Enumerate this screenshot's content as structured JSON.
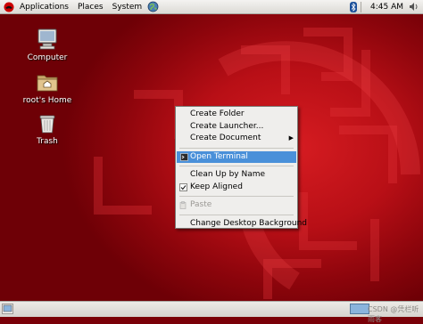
{
  "top_panel": {
    "menus": [
      "Applications",
      "Places",
      "System"
    ],
    "clock": "4:45 AM"
  },
  "desktop_icons": [
    {
      "label": "Computer",
      "icon": "computer-icon"
    },
    {
      "label": "root's Home",
      "icon": "home-folder-icon"
    },
    {
      "label": "Trash",
      "icon": "trash-icon"
    }
  ],
  "context_menu": {
    "create_folder": "Create Folder",
    "create_launcher": "Create Launcher...",
    "create_document": "Create Document",
    "open_terminal": "Open Terminal",
    "clean_up": "Clean Up by Name",
    "keep_aligned": "Keep Aligned",
    "keep_aligned_checked": true,
    "paste": "Paste",
    "change_background": "Change Desktop Background"
  },
  "bottom_panel": {
    "watermark": "CSDN @凭栏听雨客"
  },
  "colors": {
    "selection": "#4a90d9",
    "desktop_red": "#b80f16",
    "panel": "#dcdad5"
  }
}
